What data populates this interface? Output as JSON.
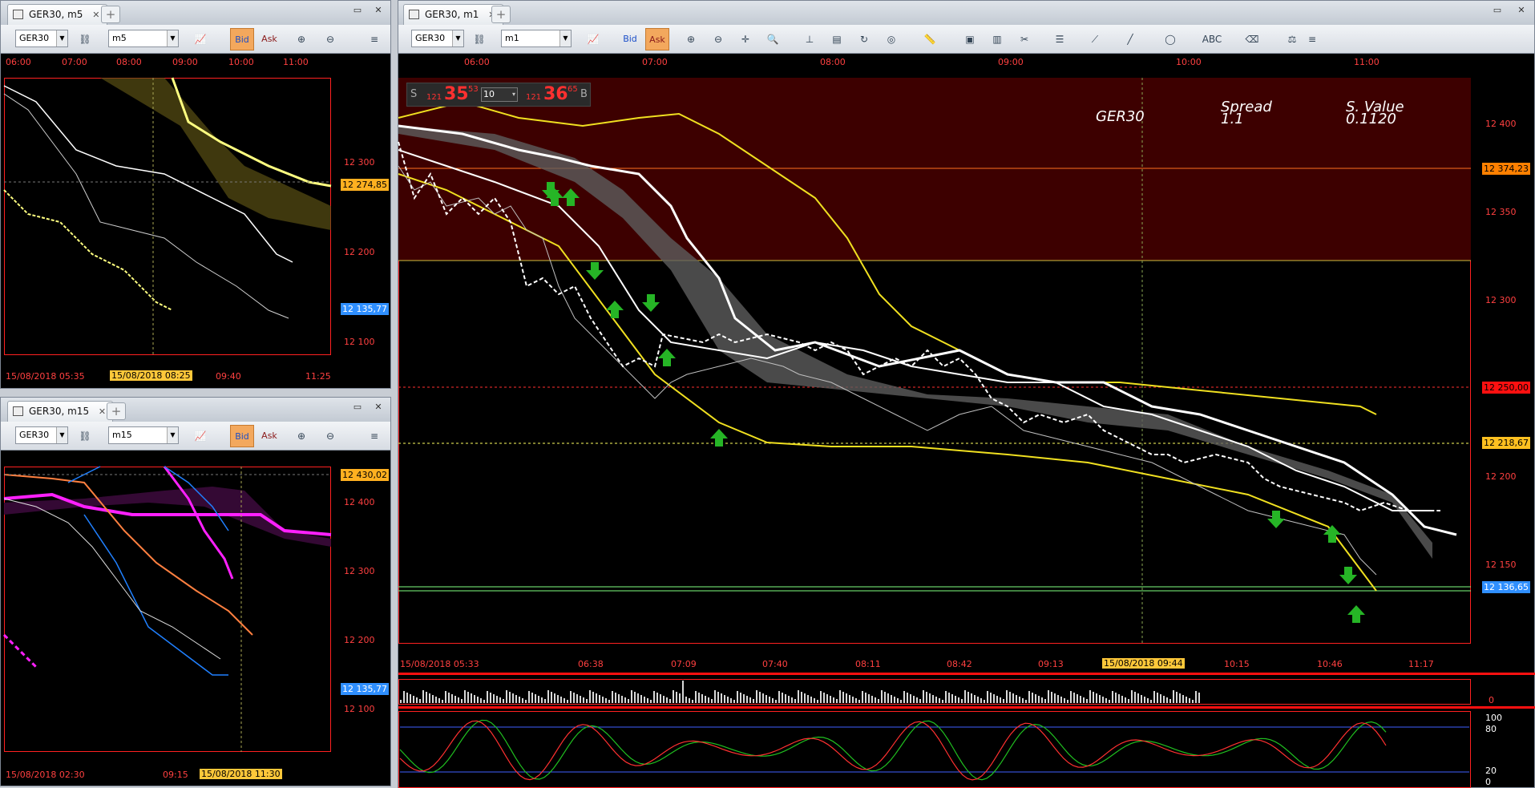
{
  "windows": {
    "m5": {
      "tab_title": "GER30, m5",
      "symbol": "GER30",
      "timeframe": "m5",
      "bid": "Bid",
      "ask": "Ask",
      "time_axis": [
        "06:00",
        "07:00",
        "08:00",
        "09:00",
        "10:00",
        "11:00"
      ],
      "price_axis": [
        "12 300",
        "12 200",
        "12 100"
      ],
      "price_badge_orange": "12 274,85",
      "price_badge_blue": "12 135,77",
      "date_axis": [
        "15/08/2018 05:35",
        "15/08/2018 08:25",
        "09:40",
        "11:25"
      ]
    },
    "m15": {
      "tab_title": "GER30, m15",
      "symbol": "GER30",
      "timeframe": "m15",
      "bid": "Bid",
      "ask": "Ask",
      "price_axis": [
        "12 400",
        "12 300",
        "12 200",
        "12 100"
      ],
      "price_badge_orange": "12 430,02",
      "price_badge_blue": "12 135,77",
      "date_axis": [
        "15/08/2018 02:30",
        "09:15",
        "15/08/2018 11:30"
      ]
    },
    "m1": {
      "tab_title": "GER30, m1",
      "symbol": "GER30",
      "timeframe": "m1",
      "bid": "Bid",
      "ask": "Ask",
      "time_axis": [
        "06:00",
        "07:00",
        "08:00",
        "09:00",
        "10:00",
        "11:00"
      ],
      "price_axis": [
        "12 400",
        "12 350",
        "12 300",
        "12 200",
        "12 150"
      ],
      "price_badge_orange1": "12 374,23",
      "price_badge_red": "12 250,00",
      "price_badge_yellow": "12 218,67",
      "price_badge_blue": "12 136,65",
      "date_axis": [
        "15/08/2018 05:33",
        "06:38",
        "07:09",
        "07:40",
        "08:11",
        "08:42",
        "09:13",
        "15/08/2018 09:44",
        "10:15",
        "10:46",
        "11:17"
      ],
      "quote": {
        "sell_label": "S",
        "sell_prefix": "121",
        "sell_big": "35",
        "sell_small": "53",
        "lot": "10",
        "buy_prefix": "121",
        "buy_big": "36",
        "buy_small": "65",
        "buy_label": "B"
      },
      "overlay": {
        "symbol": "GER30",
        "spread_label": "Spread",
        "spread_value": "1.1",
        "svalue_label": "S. Value",
        "svalue_value": "0.1120"
      },
      "osc_axis": [
        "100",
        "80",
        "20",
        "0"
      ],
      "vol_axis": "0"
    }
  },
  "colors": {
    "frame_red": "#ff2020",
    "zone_red": "#3d0000",
    "arrow_green": "#26b526",
    "ma_yellow": "#f0e020",
    "ichimoku_white": "#ffffff"
  }
}
